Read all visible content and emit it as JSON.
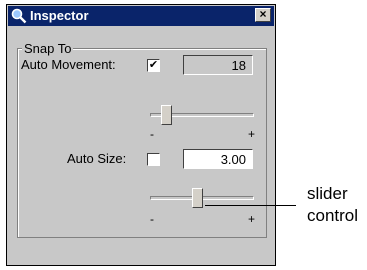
{
  "window": {
    "title": "Inspector",
    "title_icon": "magnifier-icon",
    "close_label": "×"
  },
  "snap": {
    "legend": "Snap To",
    "auto_movement": {
      "label": "Auto Movement:",
      "checked": true,
      "check_mark": "✔",
      "value": "18",
      "slider_level": 0.12
    },
    "auto_size": {
      "label": "Auto Size:",
      "checked": false,
      "value": "3.00",
      "slider_level": 0.45
    },
    "tick_min": "-",
    "tick_max": "+"
  },
  "annotation": {
    "line1": "slider",
    "line2": "control"
  }
}
